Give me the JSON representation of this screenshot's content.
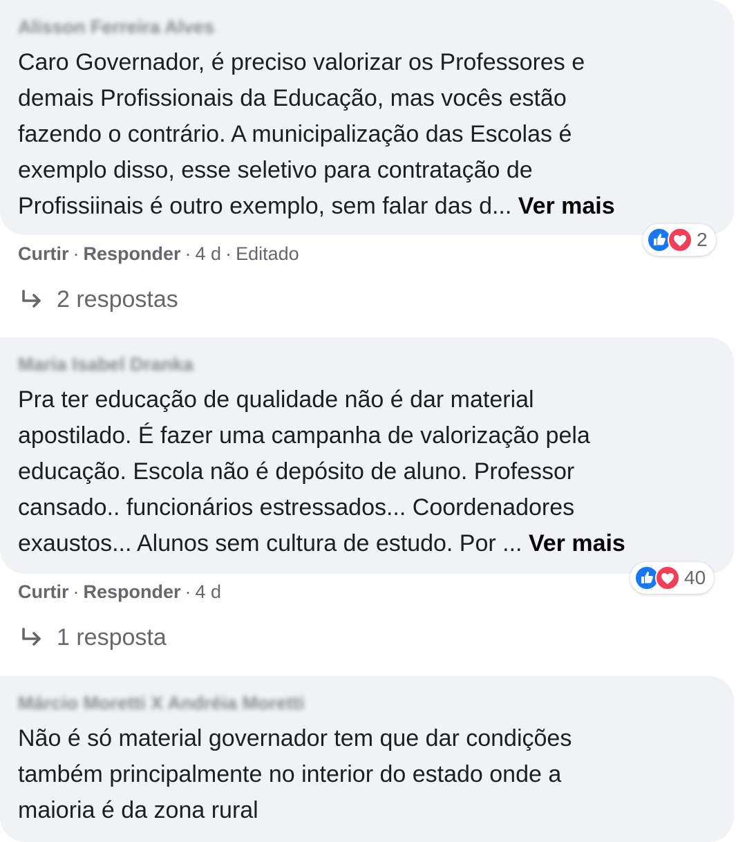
{
  "comments": [
    {
      "author": "Alisson Ferreira Alves",
      "lines": [
        "Caro Governador, é preciso valorizar os Professores e",
        "demais Profissionais da Educação, mas vocês estão",
        "fazendo o contrário. A municipalização das Escolas é",
        "exemplo disso, esse seletivo para contratação de",
        "Profissiinais é outro exemplo, sem falar das d... "
      ],
      "see_more": "Ver mais",
      "reactions": {
        "icons": [
          "like-icon",
          "love-icon"
        ],
        "count": "2"
      },
      "actions": {
        "like": "Curtir",
        "reply": "Responder",
        "time": "4 d",
        "edited": "Editado"
      },
      "replies": "2 respostas"
    },
    {
      "author": "Maria Isabel Dranka",
      "lines": [
        "Pra ter educação de qualidade não é dar material",
        "apostilado. É fazer uma campanha de valorização pela",
        "educação. Escola não é depósito de aluno. Professor",
        "cansado.. funcionários estressados... Coordenadores",
        "exaustos... Alunos sem cultura de estudo. Por ... "
      ],
      "see_more": "Ver mais",
      "reactions": {
        "icons": [
          "like-icon",
          "love-icon"
        ],
        "count": "40"
      },
      "actions": {
        "like": "Curtir",
        "reply": "Responder",
        "time": "4 d"
      },
      "replies": "1 resposta"
    },
    {
      "author": "Márcio Moretti X Andréia Moretti",
      "lines": [
        "Não é só material governador tem que dar condições",
        "também principalmente no interior do estado onde a",
        "maioria é da zona rural"
      ]
    }
  ],
  "separator": "·",
  "colors": {
    "bubble": "#f0f2f5",
    "like": "#1877f2",
    "love": "#f33e58",
    "secondary_text": "#65676b"
  }
}
